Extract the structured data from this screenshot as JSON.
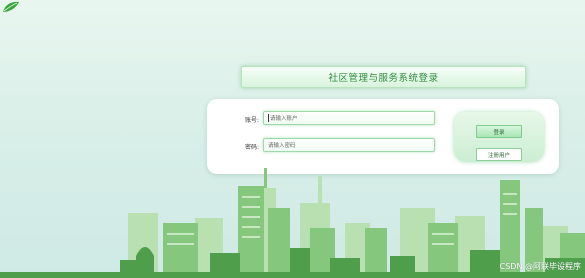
{
  "header": {
    "title": "社区管理与服务系统登录"
  },
  "form": {
    "account_label": "账号:",
    "account_placeholder": "请输入账户",
    "password_label": "密码:",
    "password_placeholder": "请输入密码"
  },
  "buttons": {
    "login": "登录",
    "register": "注册用户"
  },
  "watermark": "CSDN @阿联毕设程序",
  "colors": {
    "accent": "#2f8b3c",
    "field_border": "#9fd9a8",
    "panel": "#ffffff"
  },
  "icons": {
    "logo": "leaf-logo-icon"
  }
}
